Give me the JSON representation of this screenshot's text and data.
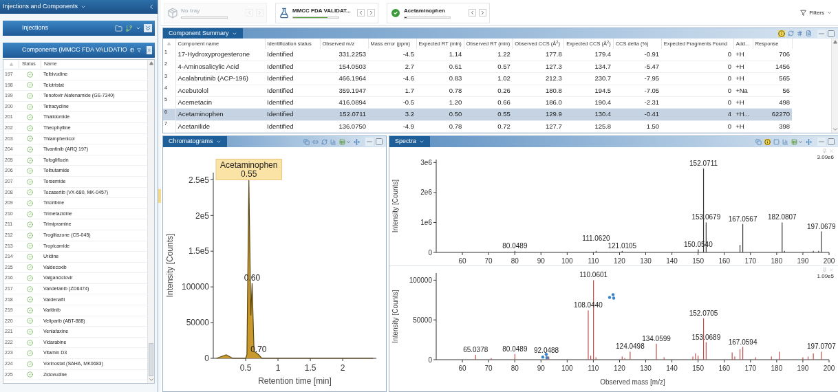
{
  "left_panel": {
    "title": "Injections and Components",
    "injections": {
      "title": "Injections"
    },
    "components": {
      "title": "Components (MMCC FDA VALIDATIO",
      "columns": [
        "Status",
        "Name"
      ],
      "rows": [
        {
          "number": "197",
          "identified": true,
          "name": "Telbivudine"
        },
        {
          "number": "198",
          "identified": true,
          "name": "Telotristat"
        },
        {
          "number": "199",
          "identified": true,
          "name": "Tenofovir Alafenamide (GS-7340)"
        },
        {
          "number": "200",
          "identified": true,
          "name": "Tetracycline"
        },
        {
          "number": "201",
          "identified": true,
          "name": "Thalidomide"
        },
        {
          "number": "202",
          "identified": true,
          "name": "Theophylline"
        },
        {
          "number": "203",
          "identified": true,
          "name": "Thiamphenicol"
        },
        {
          "number": "204",
          "identified": true,
          "name": "Tivantinib (ARQ 197)"
        },
        {
          "number": "205",
          "identified": true,
          "name": "Tofogliflozin"
        },
        {
          "number": "206",
          "identified": true,
          "name": "Tolbutamide"
        },
        {
          "number": "207",
          "identified": true,
          "name": "Torsemide"
        },
        {
          "number": "208",
          "identified": true,
          "name": "Tozasertib (VX-680, MK-0457)"
        },
        {
          "number": "209",
          "identified": true,
          "name": "Triciribine"
        },
        {
          "number": "210",
          "identified": true,
          "name": "Trimetazidine"
        },
        {
          "number": "211",
          "identified": true,
          "name": "Trimipramine"
        },
        {
          "number": "212",
          "identified": true,
          "name": "Troglitazone (CS-045)"
        },
        {
          "number": "213",
          "identified": true,
          "name": "Tropicamide"
        },
        {
          "number": "214",
          "identified": true,
          "name": "Uridine"
        },
        {
          "number": "215",
          "identified": true,
          "name": "Valdecoxib"
        },
        {
          "number": "216",
          "identified": true,
          "name": "Valganciclovir"
        },
        {
          "number": "217",
          "identified": true,
          "name": "Vandetanib (ZD6474)"
        },
        {
          "number": "218",
          "identified": true,
          "name": "Vardenafil"
        },
        {
          "number": "219",
          "identified": true,
          "name": "Varitinib"
        },
        {
          "number": "220",
          "identified": true,
          "name": "Veliparib (ABT-888)"
        },
        {
          "number": "221",
          "identified": true,
          "name": "Venlafaxine"
        },
        {
          "number": "222",
          "identified": true,
          "name": "Vidarabine"
        },
        {
          "number": "223",
          "identified": true,
          "name": "Vitamin D3"
        },
        {
          "number": "224",
          "identified": true,
          "name": "Vorinostat (SAHA, MK0683)"
        },
        {
          "number": "225",
          "identified": true,
          "name": "Zidovudine"
        }
      ]
    }
  },
  "toolbar": {
    "items": [
      {
        "kind": "tray",
        "label": "No tray",
        "disabled": true
      },
      {
        "kind": "batch",
        "label": "MMCC FDA VALIDAT...",
        "disabled": false,
        "level": 0.75,
        "color": "#5aa03c"
      },
      {
        "kind": "component",
        "label": "Acetaminophen",
        "disabled": false,
        "level": 0.05,
        "color": "#3c3c3c"
      }
    ],
    "filters": "Filters"
  },
  "component_summary": {
    "title": "Component Summary",
    "columns": [
      "Component name",
      "Identification status",
      "Observed m/z",
      "Mass error (ppm)",
      "Expected RT (min)",
      "Observed RT (min)",
      "Observed CCS (Å$^{2}$)",
      "Expected CCS (Å$^{2}$)",
      "CCS delta (%)",
      "Expected Fragments Found",
      "Add...",
      "Response"
    ],
    "rows": [
      {
        "number": "1",
        "selected": false,
        "cells": [
          "17-Hydroxyprogesterone",
          "Identified",
          "331.2253",
          "-4.5",
          "1.14",
          "1.22",
          "177.8",
          "179.4",
          "-0.91",
          "0",
          "+H",
          "706"
        ]
      },
      {
        "number": "2",
        "selected": false,
        "cells": [
          "4-Aminosalicylic Acid",
          "Identified",
          "154.0503",
          "2.7",
          "0.61",
          "0.57",
          "127.3",
          "134.7",
          "-5.47",
          "0",
          "+H",
          "1456"
        ]
      },
      {
        "number": "3",
        "selected": false,
        "cells": [
          "Acalabrutinib (ACP-196)",
          "Identified",
          "466.1964",
          "-4.6",
          "0.83",
          "1.02",
          "212.3",
          "230.7",
          "-7.95",
          "0",
          "+H",
          "565"
        ]
      },
      {
        "number": "4",
        "selected": false,
        "cells": [
          "Acebutolol",
          "Identified",
          "359.1947",
          "1.7",
          "0.78",
          "0.26",
          "180.8",
          "194.5",
          "-7.05",
          "0",
          "+Na",
          "56"
        ]
      },
      {
        "number": "5",
        "selected": false,
        "cells": [
          "Acemetacin",
          "Identified",
          "416.0894",
          "-0.5",
          "1.20",
          "0.66",
          "186.0",
          "190.4",
          "-2.31",
          "0",
          "+H",
          "498"
        ]
      },
      {
        "number": "6",
        "selected": true,
        "cells": [
          "Acetaminophen",
          "Identified",
          "152.0711",
          "3.2",
          "0.50",
          "0.55",
          "129.9",
          "130.4",
          "-0.41",
          "4",
          "+H...",
          "62270"
        ]
      },
      {
        "number": "7",
        "selected": false,
        "cells": [
          "Acetanilide",
          "Identified",
          "136.0750",
          "-4.9",
          "0.78",
          "0.72",
          "127.7",
          "125.8",
          "1.50",
          "0",
          "+H",
          "398"
        ]
      }
    ]
  },
  "chromatograms": {
    "title": "Chromatograms",
    "chart_data": {
      "type": "area",
      "xlabel": "Retention time [min]",
      "ylabel": "Intensity [Counts]",
      "xlim": [
        0,
        2.52
      ],
      "ylim": [
        0,
        260000
      ],
      "xticks": [
        0.5,
        1,
        1.5,
        2
      ],
      "yticks": [
        0,
        50000,
        100000,
        {
          "value": 150000,
          "label": "1.5e5"
        },
        {
          "value": 200000,
          "label": "2e5"
        },
        {
          "value": 250000,
          "label": "2.5e5"
        }
      ],
      "series": [
        {
          "color": "#c89a2e",
          "x": [
            0.05,
            0.2,
            0.3,
            0.5,
            0.52,
            0.55,
            0.58,
            0.6,
            0.63,
            0.7,
            0.75,
            1.1,
            1.5,
            2.0,
            2.47
          ],
          "values": [
            0,
            5000,
            0,
            0,
            5000,
            250000,
            60000,
            105000,
            10000,
            5000,
            0,
            0,
            0,
            0,
            0
          ]
        }
      ],
      "annotations": [
        {
          "x": 0.55,
          "y": 250000,
          "text": "Acetaminophen"
        },
        {
          "x": 0.55,
          "y": 250000,
          "text": "0.55"
        },
        {
          "x": 0.6,
          "y": 105000,
          "text": "0.60"
        },
        {
          "x": 0.7,
          "y": 5000,
          "text": "0.70"
        }
      ]
    }
  },
  "spectra": {
    "title": "Spectra",
    "panels": [
      {
        "scale_label": "3.09e6",
        "chart_data": {
          "type": "bar",
          "ylabel": "Intensity [Counts]",
          "xlim": [
            50,
            200
          ],
          "ylim": [
            0,
            3100000
          ],
          "xticks": [
            60,
            70,
            80,
            90,
            100,
            110,
            120,
            130,
            140,
            150,
            160,
            170,
            180,
            190,
            200
          ],
          "yticks": [
            0,
            {
              "value": 1000000,
              "label": "1e6"
            },
            {
              "value": 2000000,
              "label": "2e6"
            },
            {
              "value": 3000000,
              "label": "3e6"
            }
          ],
          "series": [
            {
              "color": "#3a3a3a",
              "x": [
                80.0489,
                111.062,
                121.0105,
                150.054,
                152.0711,
                153.0679,
                166.0,
                167.0567,
                182.0807,
                183.0,
                194.0,
                196.0,
                197.0679
              ],
              "values": [
                50000,
                50000,
                50000,
                100000,
                2800000,
                1000000,
                250000,
                950000,
                1000000,
                50000,
                50000,
                50000,
                700000
              ]
            }
          ],
          "annotations": [
            {
              "x": 80.0489,
              "y": 50000,
              "text": "80.0489"
            },
            {
              "x": 111.062,
              "y": 50000,
              "text": "111.0620"
            },
            {
              "x": 121.0105,
              "y": 50000,
              "text": "121.0105"
            },
            {
              "x": 150.054,
              "y": 100000,
              "text": "150.0540"
            },
            {
              "x": 152.0711,
              "y": 2800000,
              "text": "152.0711"
            },
            {
              "x": 153.0679,
              "y": 1000000,
              "text": "153.0679"
            },
            {
              "x": 167.0567,
              "y": 950000,
              "text": "167.0567"
            },
            {
              "x": 182.0807,
              "y": 1000000,
              "text": "182.0807"
            },
            {
              "x": 197.0679,
              "y": 700000,
              "text": "197.0679"
            }
          ]
        }
      },
      {
        "scale_label": "1.09e5",
        "chart_data": {
          "type": "bar",
          "xlabel": "Observed mass [m/z]",
          "ylabel": "Intensity [Counts]",
          "xlim": [
            50,
            200
          ],
          "ylim": [
            0,
            109000
          ],
          "xticks": [
            60,
            70,
            80,
            90,
            100,
            110,
            120,
            130,
            140,
            150,
            160,
            170,
            180,
            190,
            200
          ],
          "yticks": [
            0,
            50000,
            100000
          ],
          "series": [
            {
              "color": "#c0504d",
              "x": [
                65.0378,
                71,
                80.0489,
                92.0488,
                93,
                108.044,
                109,
                110.0601,
                111,
                121,
                122,
                124.0498,
                134.0599,
                137,
                148,
                149,
                150,
                152.0705,
                153.0689,
                163,
                164,
                166,
                167.0594,
                172,
                178,
                181,
                190,
                192,
                194,
                197.0707
              ],
              "values": [
                6000,
                2000,
                7000,
                5000,
                4000,
                62000,
                5000,
                100000,
                3000,
                4000,
                2000,
                10000,
                20000,
                3000,
                4000,
                8000,
                5000,
                52000,
                22000,
                9000,
                4000,
                13000,
                16000,
                3000,
                4000,
                10000,
                3000,
                4000,
                8000,
                10000
              ]
            }
          ],
          "annotations": [
            {
              "x": 65.0378,
              "y": 6000,
              "text": "65.0378"
            },
            {
              "x": 80.0489,
              "y": 7000,
              "text": "80.0489"
            },
            {
              "x": 92.0488,
              "y": 5000,
              "text": "92.0488"
            },
            {
              "x": 108.044,
              "y": 62000,
              "text": "108.0440"
            },
            {
              "x": 110.0601,
              "y": 100000,
              "text": "110.0601"
            },
            {
              "x": 124.0498,
              "y": 10000,
              "text": "124.0498"
            },
            {
              "x": 134.0599,
              "y": 20000,
              "text": "134.0599"
            },
            {
              "x": 152.0705,
              "y": 52000,
              "text": "152.0705"
            },
            {
              "x": 153.0689,
              "y": 22000,
              "text": "153.0689"
            },
            {
              "x": 167.0594,
              "y": 16000,
              "text": "167.0594"
            },
            {
              "x": 197.0707,
              "y": 10000,
              "text": "197.0707"
            }
          ]
        }
      }
    ]
  }
}
